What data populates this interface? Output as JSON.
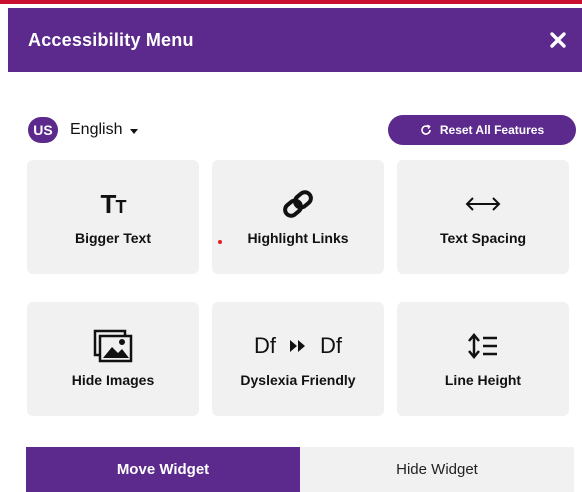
{
  "header": {
    "title": "Accessibility Menu"
  },
  "language": {
    "code": "US",
    "label": "English"
  },
  "reset": {
    "label": "Reset All Features"
  },
  "cards": [
    {
      "label": "Bigger Text",
      "icon": "bigger-text-icon"
    },
    {
      "label": "Highlight Links",
      "icon": "link-icon"
    },
    {
      "label": "Text Spacing",
      "icon": "text-spacing-icon"
    },
    {
      "label": "Hide Images",
      "icon": "hide-images-icon"
    },
    {
      "label": "Dyslexia Friendly",
      "icon": "dyslexia-icon"
    },
    {
      "label": "Line Height",
      "icon": "line-height-icon"
    }
  ],
  "icons": {
    "tt_big": "T",
    "tt_small": "T",
    "dys_left": "Df",
    "dys_right": "Df"
  },
  "widget": {
    "move_label": "Move Widget",
    "hide_label": "Hide Widget"
  },
  "colors": {
    "brand": "#5b2a8c",
    "accent_red": "#c8102e",
    "card_bg": "#f1f1f1"
  }
}
